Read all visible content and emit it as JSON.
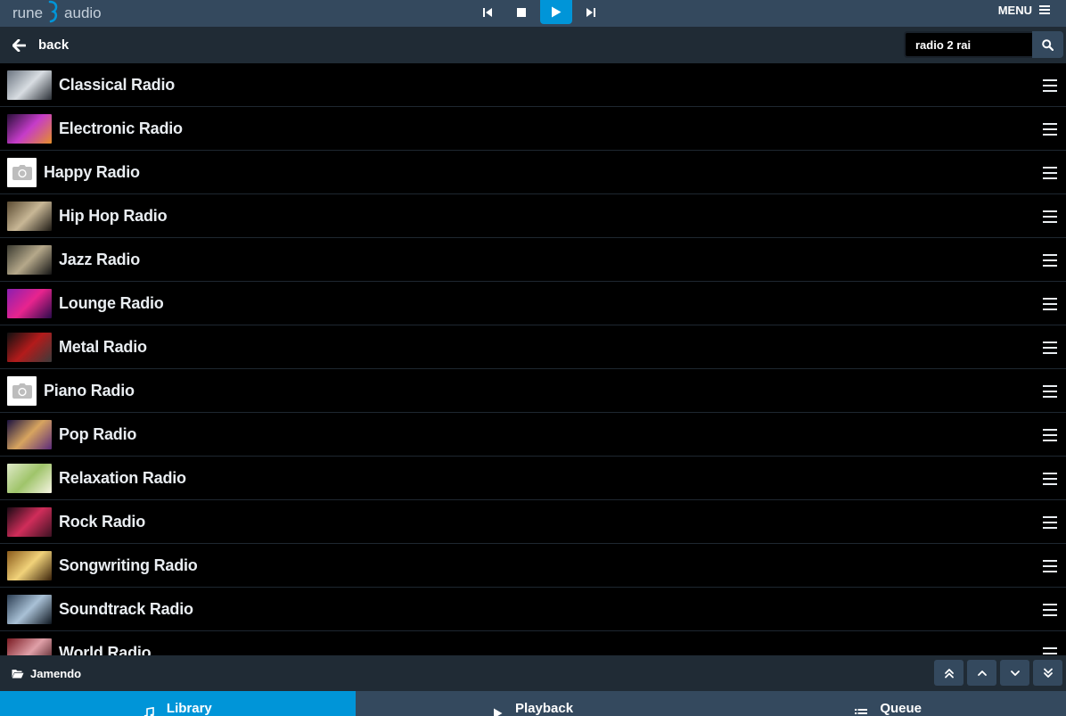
{
  "app": {
    "logo_left": "rune",
    "logo_right": "audio",
    "menu_label": "MENU"
  },
  "transport": {
    "buttons": [
      "previous-icon",
      "stop-icon",
      "play-icon",
      "next-icon"
    ],
    "accent": "#0095d8"
  },
  "nav": {
    "back_label": "back"
  },
  "search": {
    "value": "radio 2 rai"
  },
  "stations": [
    {
      "label": "Classical Radio",
      "thumb": "photo",
      "colors": [
        "#6b7480",
        "#d8dde2",
        "#2a2f36"
      ]
    },
    {
      "label": "Electronic Radio",
      "thumb": "photo",
      "colors": [
        "#2a0f3a",
        "#c53cc9",
        "#e58f2a"
      ]
    },
    {
      "label": "Happy Radio",
      "thumb": "camera-placeholder-icon"
    },
    {
      "label": "Hip Hop Radio",
      "thumb": "photo",
      "colors": [
        "#5b4b32",
        "#c8b796",
        "#1e1a14"
      ]
    },
    {
      "label": "Jazz Radio",
      "thumb": "photo",
      "colors": [
        "#3a3a30",
        "#b5a88a",
        "#141414"
      ]
    },
    {
      "label": "Lounge Radio",
      "thumb": "photo",
      "colors": [
        "#8b1fb0",
        "#e8248e",
        "#2a0b4b"
      ]
    },
    {
      "label": "Metal Radio",
      "thumb": "photo",
      "colors": [
        "#101010",
        "#b31b1b",
        "#3b3b3b"
      ]
    },
    {
      "label": "Piano Radio",
      "thumb": "camera-placeholder-icon"
    },
    {
      "label": "Pop Radio",
      "thumb": "photo",
      "colors": [
        "#1b1240",
        "#d7a45f",
        "#5b2a7a"
      ]
    },
    {
      "label": "Relaxation Radio",
      "thumb": "photo",
      "colors": [
        "#dfe9c8",
        "#9fc46a",
        "#f6f4e2"
      ]
    },
    {
      "label": "Rock Radio",
      "thumb": "photo",
      "colors": [
        "#1a0a14",
        "#d02d5a",
        "#3c1222"
      ]
    },
    {
      "label": "Songwriting Radio",
      "thumb": "photo",
      "colors": [
        "#8a5a1a",
        "#f1d27a",
        "#3b230a"
      ]
    },
    {
      "label": "Soundtrack Radio",
      "thumb": "photo",
      "colors": [
        "#2b3d52",
        "#a9c1d6",
        "#0f1720"
      ]
    },
    {
      "label": "World Radio",
      "thumb": "photo",
      "colors": [
        "#7a1a22",
        "#e0a0a8",
        "#3a0a10"
      ]
    }
  ],
  "footer": {
    "breadcrumb": "Jamendo",
    "scroll_buttons": [
      "scroll-top-icon",
      "scroll-up-icon",
      "scroll-down-icon",
      "scroll-bottom-icon"
    ]
  },
  "tabs": [
    {
      "label": "Library",
      "icon": "music-note-icon",
      "active": true
    },
    {
      "label": "Playback",
      "icon": "play-icon",
      "active": false
    },
    {
      "label": "Queue",
      "icon": "list-icon",
      "active": false
    }
  ]
}
